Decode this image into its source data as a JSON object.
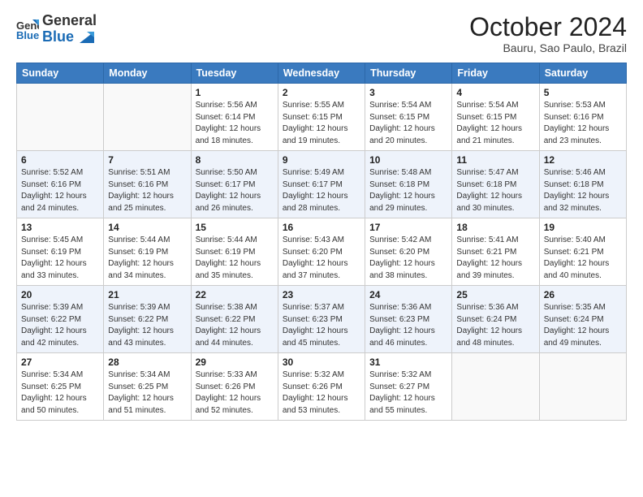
{
  "header": {
    "logo_general": "General",
    "logo_blue": "Blue",
    "month_year": "October 2024",
    "location": "Bauru, Sao Paulo, Brazil"
  },
  "weekdays": [
    "Sunday",
    "Monday",
    "Tuesday",
    "Wednesday",
    "Thursday",
    "Friday",
    "Saturday"
  ],
  "weeks": [
    [
      {
        "day": "",
        "info": ""
      },
      {
        "day": "",
        "info": ""
      },
      {
        "day": "1",
        "info": "Sunrise: 5:56 AM\nSunset: 6:14 PM\nDaylight: 12 hours and 18 minutes."
      },
      {
        "day": "2",
        "info": "Sunrise: 5:55 AM\nSunset: 6:15 PM\nDaylight: 12 hours and 19 minutes."
      },
      {
        "day": "3",
        "info": "Sunrise: 5:54 AM\nSunset: 6:15 PM\nDaylight: 12 hours and 20 minutes."
      },
      {
        "day": "4",
        "info": "Sunrise: 5:54 AM\nSunset: 6:15 PM\nDaylight: 12 hours and 21 minutes."
      },
      {
        "day": "5",
        "info": "Sunrise: 5:53 AM\nSunset: 6:16 PM\nDaylight: 12 hours and 23 minutes."
      }
    ],
    [
      {
        "day": "6",
        "info": "Sunrise: 5:52 AM\nSunset: 6:16 PM\nDaylight: 12 hours and 24 minutes."
      },
      {
        "day": "7",
        "info": "Sunrise: 5:51 AM\nSunset: 6:16 PM\nDaylight: 12 hours and 25 minutes."
      },
      {
        "day": "8",
        "info": "Sunrise: 5:50 AM\nSunset: 6:17 PM\nDaylight: 12 hours and 26 minutes."
      },
      {
        "day": "9",
        "info": "Sunrise: 5:49 AM\nSunset: 6:17 PM\nDaylight: 12 hours and 28 minutes."
      },
      {
        "day": "10",
        "info": "Sunrise: 5:48 AM\nSunset: 6:18 PM\nDaylight: 12 hours and 29 minutes."
      },
      {
        "day": "11",
        "info": "Sunrise: 5:47 AM\nSunset: 6:18 PM\nDaylight: 12 hours and 30 minutes."
      },
      {
        "day": "12",
        "info": "Sunrise: 5:46 AM\nSunset: 6:18 PM\nDaylight: 12 hours and 32 minutes."
      }
    ],
    [
      {
        "day": "13",
        "info": "Sunrise: 5:45 AM\nSunset: 6:19 PM\nDaylight: 12 hours and 33 minutes."
      },
      {
        "day": "14",
        "info": "Sunrise: 5:44 AM\nSunset: 6:19 PM\nDaylight: 12 hours and 34 minutes."
      },
      {
        "day": "15",
        "info": "Sunrise: 5:44 AM\nSunset: 6:19 PM\nDaylight: 12 hours and 35 minutes."
      },
      {
        "day": "16",
        "info": "Sunrise: 5:43 AM\nSunset: 6:20 PM\nDaylight: 12 hours and 37 minutes."
      },
      {
        "day": "17",
        "info": "Sunrise: 5:42 AM\nSunset: 6:20 PM\nDaylight: 12 hours and 38 minutes."
      },
      {
        "day": "18",
        "info": "Sunrise: 5:41 AM\nSunset: 6:21 PM\nDaylight: 12 hours and 39 minutes."
      },
      {
        "day": "19",
        "info": "Sunrise: 5:40 AM\nSunset: 6:21 PM\nDaylight: 12 hours and 40 minutes."
      }
    ],
    [
      {
        "day": "20",
        "info": "Sunrise: 5:39 AM\nSunset: 6:22 PM\nDaylight: 12 hours and 42 minutes."
      },
      {
        "day": "21",
        "info": "Sunrise: 5:39 AM\nSunset: 6:22 PM\nDaylight: 12 hours and 43 minutes."
      },
      {
        "day": "22",
        "info": "Sunrise: 5:38 AM\nSunset: 6:22 PM\nDaylight: 12 hours and 44 minutes."
      },
      {
        "day": "23",
        "info": "Sunrise: 5:37 AM\nSunset: 6:23 PM\nDaylight: 12 hours and 45 minutes."
      },
      {
        "day": "24",
        "info": "Sunrise: 5:36 AM\nSunset: 6:23 PM\nDaylight: 12 hours and 46 minutes."
      },
      {
        "day": "25",
        "info": "Sunrise: 5:36 AM\nSunset: 6:24 PM\nDaylight: 12 hours and 48 minutes."
      },
      {
        "day": "26",
        "info": "Sunrise: 5:35 AM\nSunset: 6:24 PM\nDaylight: 12 hours and 49 minutes."
      }
    ],
    [
      {
        "day": "27",
        "info": "Sunrise: 5:34 AM\nSunset: 6:25 PM\nDaylight: 12 hours and 50 minutes."
      },
      {
        "day": "28",
        "info": "Sunrise: 5:34 AM\nSunset: 6:25 PM\nDaylight: 12 hours and 51 minutes."
      },
      {
        "day": "29",
        "info": "Sunrise: 5:33 AM\nSunset: 6:26 PM\nDaylight: 12 hours and 52 minutes."
      },
      {
        "day": "30",
        "info": "Sunrise: 5:32 AM\nSunset: 6:26 PM\nDaylight: 12 hours and 53 minutes."
      },
      {
        "day": "31",
        "info": "Sunrise: 5:32 AM\nSunset: 6:27 PM\nDaylight: 12 hours and 55 minutes."
      },
      {
        "day": "",
        "info": ""
      },
      {
        "day": "",
        "info": ""
      }
    ]
  ]
}
